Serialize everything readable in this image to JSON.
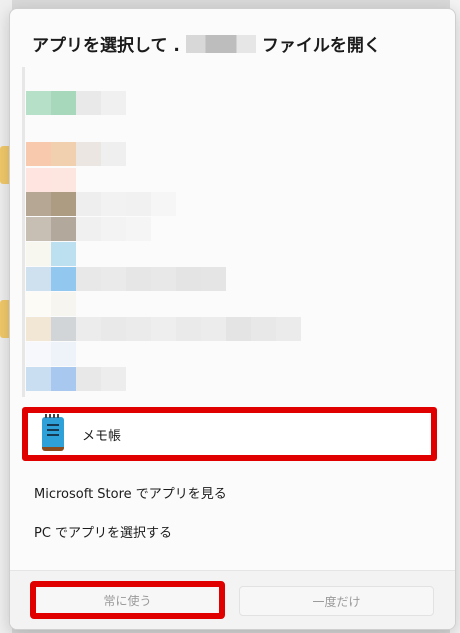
{
  "dialog": {
    "title_prefix": "アプリを選択して .",
    "title_suffix": "ファイルを開く"
  },
  "app_list": {
    "blurred_rows": [
      {
        "colors": [
          "#b6e0c8",
          "#a7d8bc",
          "#e9e9e9",
          "#f0f0f0"
        ]
      },
      {
        "colors": [
          "#f8c9ad",
          "#f1d0b0",
          "#ebe6e2",
          "#efefef"
        ]
      },
      {
        "colors": [
          "#ffe4df",
          "#fde5e0"
        ]
      },
      {
        "colors": [
          "#b5a793",
          "#ad9c82",
          "#eeeeee",
          "#f2f2f2",
          "#f1f1f1",
          "#f6f6f6"
        ]
      },
      {
        "colors": [
          "#c7bfb3",
          "#b2a89b",
          "#f0f0f0",
          "#f3f3f3",
          "#f5f5f5"
        ]
      },
      {
        "colors": [
          "#f7f7f0",
          "#bde0f1"
        ]
      },
      {
        "colors": [
          "#cfe1ef",
          "#92c8ef",
          "#e8e8e8",
          "#eaeaea",
          "#e6e6e6",
          "#e8e8e8",
          "#e4e4e4",
          "#e5e5e5"
        ]
      },
      {
        "colors": [
          "#fdfbf5",
          "#f7f5ef"
        ]
      },
      {
        "colors": [
          "#f2e7d4",
          "#d1d5d8",
          "#ececec",
          "#e9e9e9",
          "#ebebeb",
          "#eeeeee",
          "#eaeaea",
          "#ececec",
          "#e4e4e4",
          "#e8e8e8",
          "#ebebeb"
        ]
      },
      {
        "colors": [
          "#f6f8fb",
          "#eef3fa"
        ]
      },
      {
        "colors": [
          "#c9def1",
          "#a8c8ef",
          "#e8e8e8",
          "#ededed"
        ]
      }
    ]
  },
  "selected_app": {
    "label": "メモ帳",
    "icon": "notepad-icon"
  },
  "links": {
    "store": "Microsoft Store でアプリを見る",
    "pc": "PC でアプリを選択する"
  },
  "buttons": {
    "always": "常に使う",
    "once": "一度だけ"
  },
  "colors": {
    "highlight": "#e00000"
  }
}
